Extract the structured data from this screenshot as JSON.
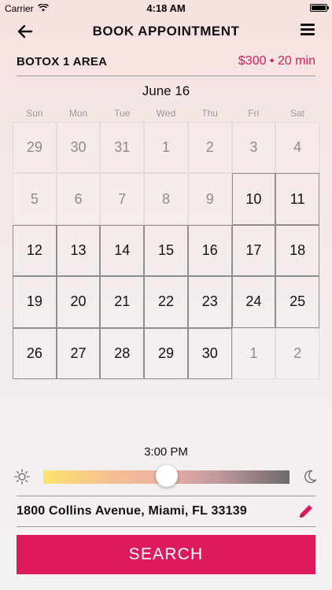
{
  "status_bar": {
    "carrier": "Carrier",
    "time": "4:18 AM",
    "icons": [
      "wifi-icon",
      "battery-icon"
    ]
  },
  "nav": {
    "title": "BOOK APPOINTMENT",
    "back_icon": "back-arrow-icon",
    "menu_icon": "menu-icon"
  },
  "service": {
    "name": "BOTOX 1 AREA",
    "price_duration": "$300 • 20 min"
  },
  "calendar": {
    "month_label": "June 16",
    "weekdays": [
      "Sun",
      "Mon",
      "Tue",
      "Wed",
      "Thu",
      "Fri",
      "Sat"
    ],
    "days": [
      {
        "label": "29",
        "available": false
      },
      {
        "label": "30",
        "available": false
      },
      {
        "label": "31",
        "available": false
      },
      {
        "label": "1",
        "available": false
      },
      {
        "label": "2",
        "available": false
      },
      {
        "label": "3",
        "available": false
      },
      {
        "label": "4",
        "available": false
      },
      {
        "label": "5",
        "available": false
      },
      {
        "label": "6",
        "available": false
      },
      {
        "label": "7",
        "available": false
      },
      {
        "label": "8",
        "available": false
      },
      {
        "label": "9",
        "available": false
      },
      {
        "label": "10",
        "available": true
      },
      {
        "label": "11",
        "available": true
      },
      {
        "label": "12",
        "available": true
      },
      {
        "label": "13",
        "available": true
      },
      {
        "label": "14",
        "available": true
      },
      {
        "label": "15",
        "available": true
      },
      {
        "label": "16",
        "available": true
      },
      {
        "label": "17",
        "available": true
      },
      {
        "label": "18",
        "available": true
      },
      {
        "label": "19",
        "available": true
      },
      {
        "label": "20",
        "available": true
      },
      {
        "label": "21",
        "available": true
      },
      {
        "label": "22",
        "available": true
      },
      {
        "label": "23",
        "available": true
      },
      {
        "label": "24",
        "available": true
      },
      {
        "label": "25",
        "available": true
      },
      {
        "label": "26",
        "available": true
      },
      {
        "label": "27",
        "available": true
      },
      {
        "label": "28",
        "available": true
      },
      {
        "label": "29",
        "available": true
      },
      {
        "label": "30",
        "available": true
      },
      {
        "label": "1",
        "available": false
      },
      {
        "label": "2",
        "available": false
      }
    ]
  },
  "time_slider": {
    "label": "3:00 PM",
    "value_fraction": 0.5,
    "left_icon": "sun-icon",
    "right_icon": "moon-icon"
  },
  "address": {
    "text": "1800 Collins Avenue, Miami, FL 33139",
    "edit_icon": "pencil-icon"
  },
  "search": {
    "label": "SEARCH"
  },
  "colors": {
    "accent": "#dd1a5c",
    "price": "#d81b60"
  }
}
